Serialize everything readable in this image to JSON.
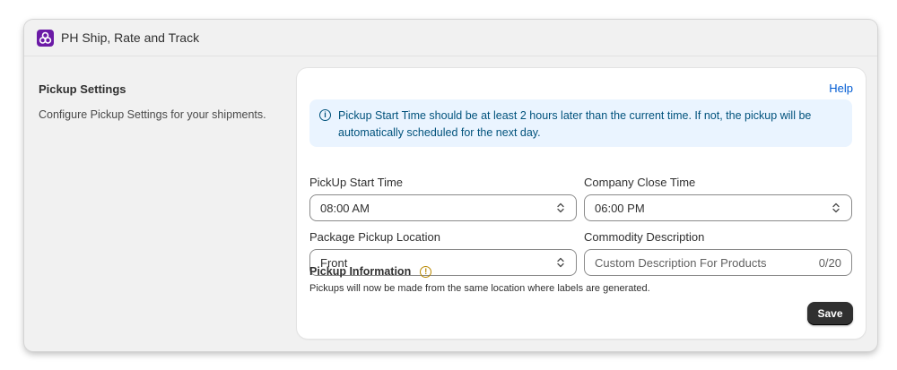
{
  "app": {
    "title": "PH Ship, Rate and Track",
    "icon": "app-logo-icon",
    "brand_color": "#6b1aa6"
  },
  "section": {
    "title": "Pickup Settings",
    "description": "Configure Pickup Settings for your shipments."
  },
  "card": {
    "help_label": "Help",
    "banner_text": "Pickup Start Time should be at least 2 hours later than the current time. If not, the pickup will be automatically scheduled for the next day.",
    "banner_icon": "info-icon"
  },
  "fields": {
    "pickup_start_time": {
      "label": "PickUp Start Time",
      "value": "08:00 AM"
    },
    "company_close_time": {
      "label": "Company Close Time",
      "value": "06:00 PM"
    },
    "package_pickup_location": {
      "label": "Package Pickup Location",
      "value": "Front"
    },
    "commodity_description": {
      "label": "Commodity Description",
      "value": "",
      "placeholder": "Custom Description For Products",
      "counter": "0/20"
    }
  },
  "pickup_info": {
    "title": "Pickup Information",
    "text": "Pickups will now be made from the same location where labels are generated.",
    "icon": "warning-icon"
  },
  "actions": {
    "save_label": "Save"
  },
  "colors": {
    "link": "#005bd3",
    "banner_bg": "#eaf4ff",
    "banner_text": "#00527c",
    "warning": "#b98900",
    "primary_button": "#303030"
  }
}
